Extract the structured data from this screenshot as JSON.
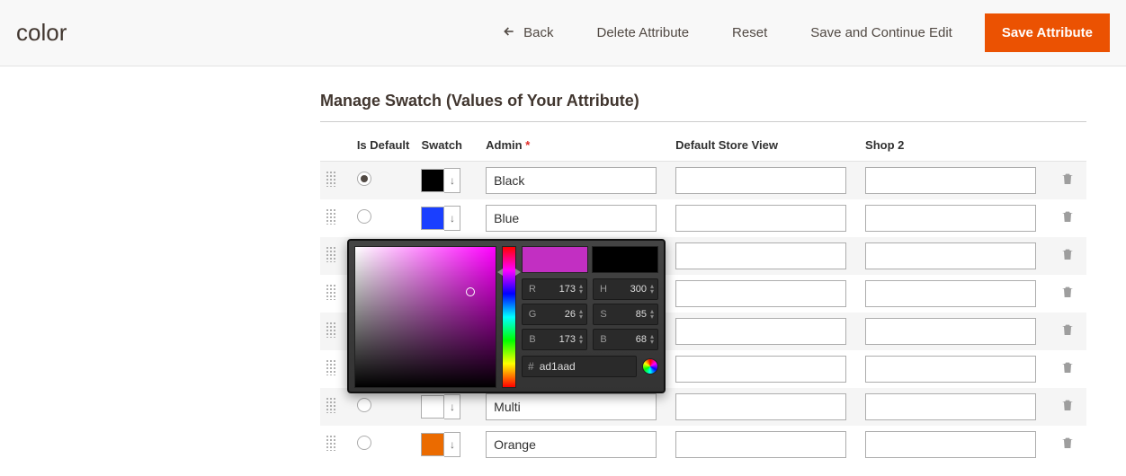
{
  "page": {
    "title": "color"
  },
  "toolbar": {
    "back": "Back",
    "delete": "Delete Attribute",
    "reset": "Reset",
    "save_continue": "Save and Continue Edit",
    "save": "Save Attribute"
  },
  "section": {
    "title": "Manage Swatch (Values of Your Attribute)"
  },
  "columns": {
    "is_default": "Is Default",
    "swatch": "Swatch",
    "admin": "Admin",
    "required": "*",
    "dsv": "Default Store View",
    "shop2": "Shop 2"
  },
  "rows": [
    {
      "default": true,
      "swatch_color": "#000000",
      "admin": "Black",
      "dsv": "",
      "shop2": ""
    },
    {
      "default": false,
      "swatch_color": "#1a3fff",
      "admin": "Blue",
      "dsv": "",
      "shop2": ""
    },
    {
      "default": false,
      "swatch_color": "#ad1aad",
      "admin": "",
      "dsv": "",
      "shop2": ""
    },
    {
      "default": false,
      "swatch_color": "",
      "admin": "",
      "dsv": "",
      "shop2": ""
    },
    {
      "default": false,
      "swatch_color": "",
      "admin": "",
      "dsv": "",
      "shop2": ""
    },
    {
      "default": false,
      "swatch_color": "",
      "admin": "",
      "dsv": "",
      "shop2": ""
    },
    {
      "default": false,
      "swatch_color": "#ffffff",
      "admin": "Multi",
      "dsv": "",
      "shop2": ""
    },
    {
      "default": false,
      "swatch_color": "#eb6b00",
      "admin": "Orange",
      "dsv": "",
      "shop2": ""
    }
  ],
  "colorpicker": {
    "R": "173",
    "G": "26",
    "B": "173",
    "H": "300",
    "S": "85",
    "Br": "68",
    "hex": "ad1aad"
  }
}
